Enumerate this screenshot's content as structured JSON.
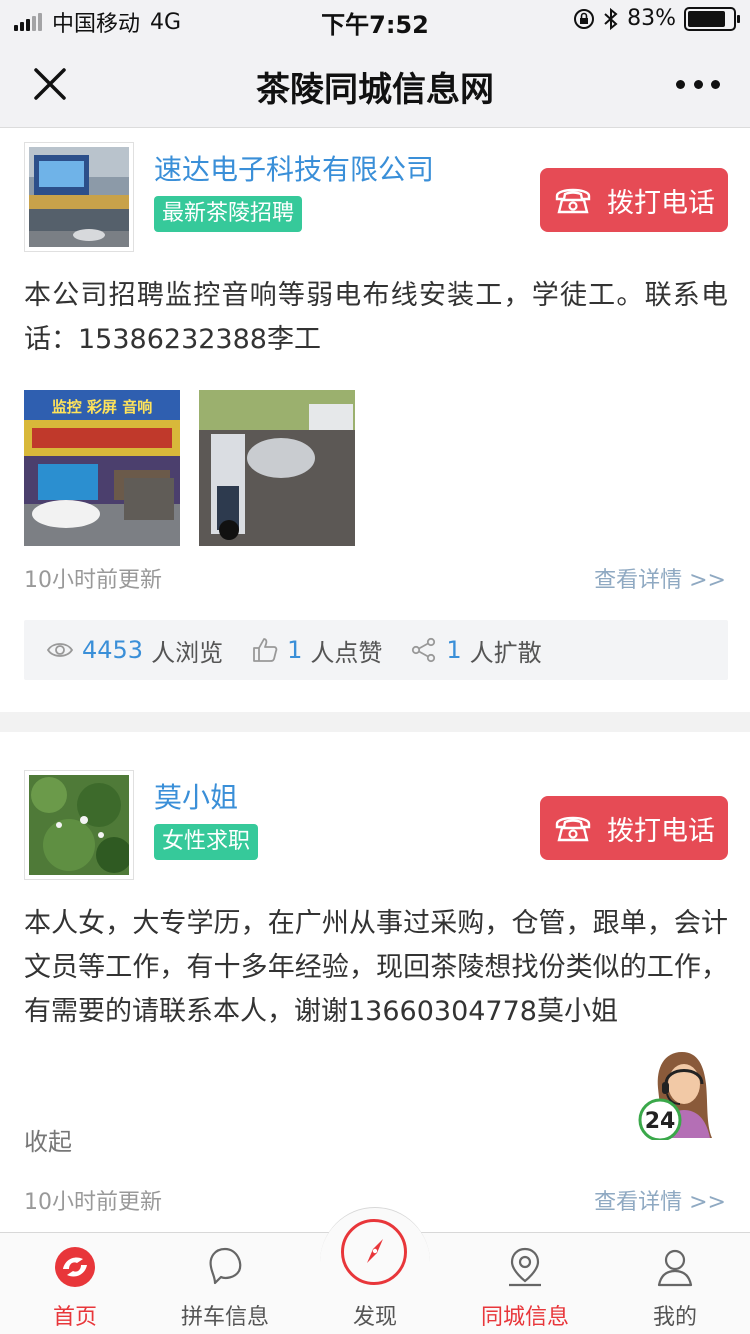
{
  "status_bar": {
    "carrier": "中国移动",
    "network": "4G",
    "time": "下午7:52",
    "battery": "83%",
    "battery_level": 0.83
  },
  "nav": {
    "title": "茶陵同城信息网"
  },
  "posts": [
    {
      "author": "速达电子科技有限公司",
      "tag": "最新茶陵招聘",
      "call_label": "拨打电话",
      "content": "本公司招聘监控音响等弱电布线安装工，学徒工。联系电话：15386232388李工",
      "photo_text": "监控 彩屏 音响",
      "updated": "10小时前更新",
      "detail": "查看详情 >>",
      "views": "4453",
      "views_suffix": "人浏览",
      "likes": "1",
      "likes_suffix": "人点赞",
      "shares": "1",
      "shares_suffix": "人扩散"
    },
    {
      "author": "莫小姐",
      "tag": "女性求职",
      "call_label": "拨打电话",
      "content": "本人女，大专学历，在广州从事过采购，仓管，跟单，会计文员等工作，有十多年经验，现回茶陵想找份类似的工作，有需要的请联系本人，谢谢13660304778莫小姐",
      "collapse": "收起",
      "updated": "10小时前更新",
      "detail": "查看详情 >>"
    }
  ],
  "service_badge": "24",
  "tabbar": {
    "items": [
      {
        "label": "首页"
      },
      {
        "label": "拼车信息"
      },
      {
        "label": "发现"
      },
      {
        "label": "同城信息"
      },
      {
        "label": "我的"
      }
    ]
  },
  "colors": {
    "accent_red": "#e64b55",
    "tag_green": "#36c99a",
    "link_blue": "#3a8fd8"
  }
}
